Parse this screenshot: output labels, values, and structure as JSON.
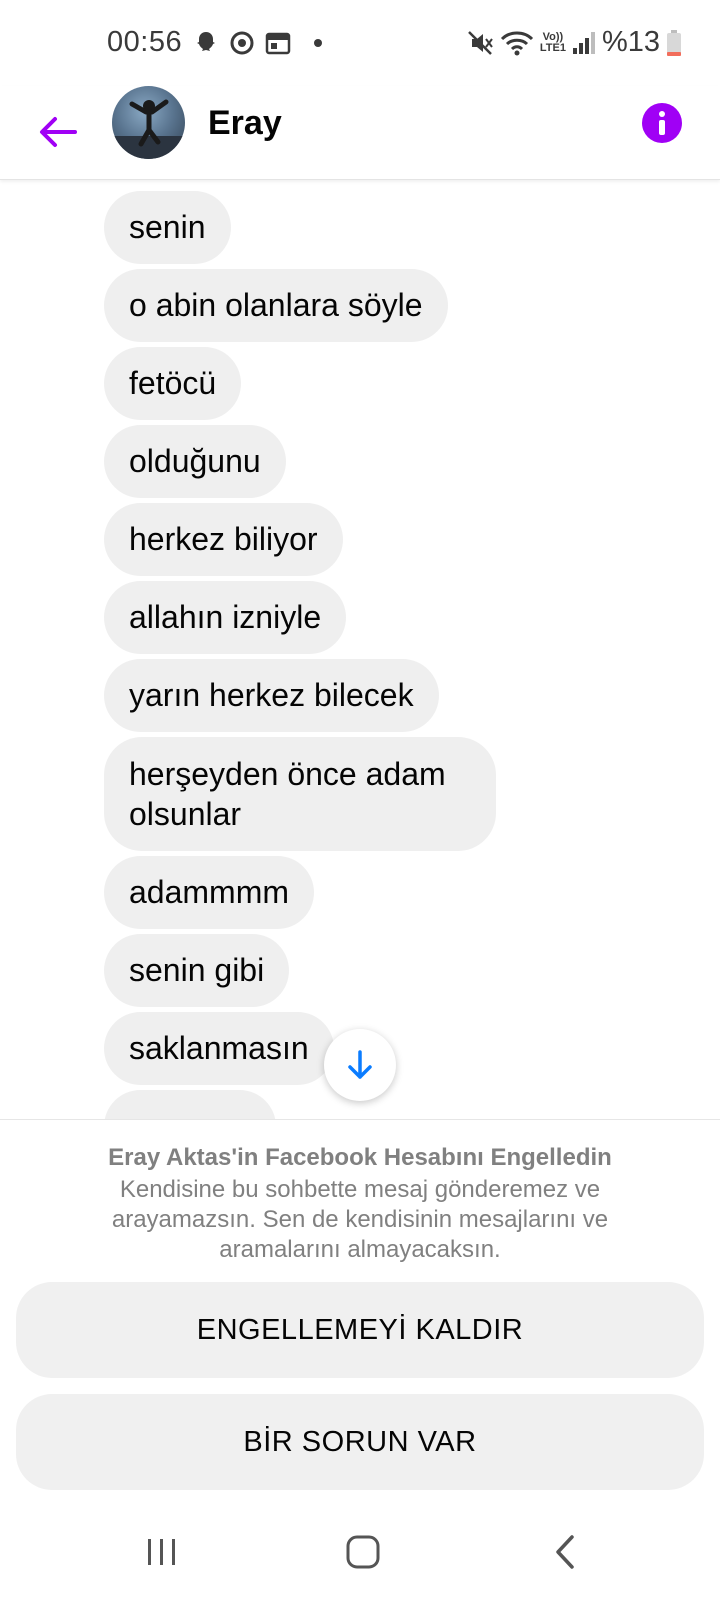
{
  "status_bar": {
    "time": "00:56",
    "left_icons": [
      "snapchat-icon",
      "sync-icon",
      "calendar-icon",
      "dot-icon"
    ],
    "right_icons": [
      "mute-icon",
      "wifi-icon",
      "volte-icon",
      "signal-icon",
      "battery-icon"
    ],
    "volte_top": "Vo))",
    "volte_bottom": "LTE1",
    "battery": "%13",
    "battery_color": "#f26d5b"
  },
  "header": {
    "contact_name": "Eray",
    "accent_color": "#a000f5",
    "back_icon": "arrow-left-icon",
    "info_icon": "info-icon"
  },
  "messages": [
    {
      "text": "senin"
    },
    {
      "text": "o abin olanlara söyle"
    },
    {
      "text": "fetöcü"
    },
    {
      "text": "olduğunu"
    },
    {
      "text": "herkez biliyor"
    },
    {
      "text": "allahın izniyle"
    },
    {
      "text": "yarın herkez bilecek"
    },
    {
      "text": "herşeyden önce adam olsunlar"
    },
    {
      "text": "adammmm"
    },
    {
      "text": "senin gibi"
    },
    {
      "text": "saklanmasın"
    }
  ],
  "scroll_button": {
    "icon": "arrow-down-icon",
    "color": "#0a7cff"
  },
  "block_notice": {
    "title": "Eray Aktas'in Facebook Hesabını Engelledin",
    "description": "Kendisine bu sohbette mesaj gönderemez ve arayamazsın. Sen de kendisinin mesajlarını ve aramalarını almayacaksın."
  },
  "actions": {
    "unblock_label": "ENGELLEMEYİ KALDIR",
    "report_label": "BİR SORUN VAR"
  },
  "nav_bar": {
    "icons": [
      "recent-apps-icon",
      "home-icon",
      "back-nav-icon"
    ]
  }
}
